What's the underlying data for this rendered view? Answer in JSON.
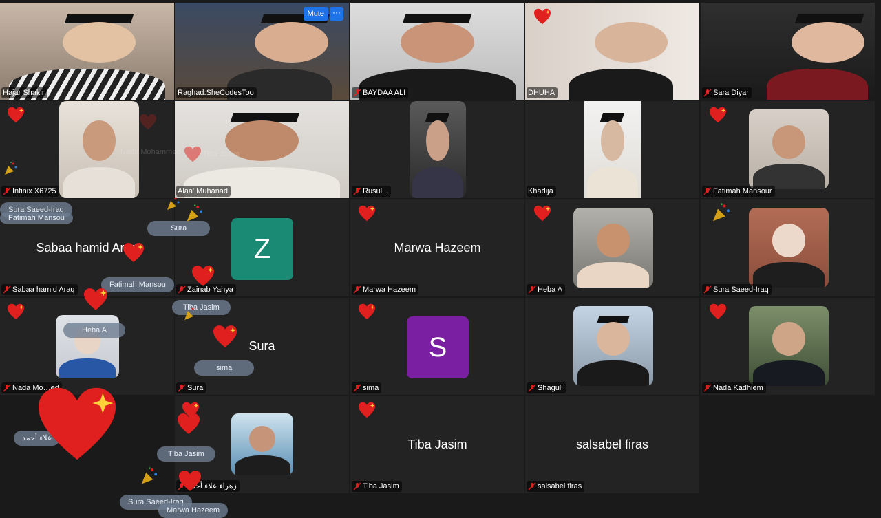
{
  "participants": [
    {
      "name": "Hajar Shakir",
      "mic_muted": false
    },
    {
      "name": "Raghad:SheCodesToo",
      "mic_muted": false
    },
    {
      "name": "BAYDAA ALI",
      "mic_muted": true
    },
    {
      "name": "DHUHA",
      "mic_muted": false
    },
    {
      "name": "Sara Diyar",
      "mic_muted": true
    },
    {
      "name": "Infinix X6725",
      "mic_muted": true
    },
    {
      "name": "Alaa' Muhanad",
      "mic_muted": false
    },
    {
      "name": "Rusul ..",
      "mic_muted": true
    },
    {
      "name": "Khadija",
      "mic_muted": false
    },
    {
      "name": "Fatimah Mansour",
      "mic_muted": true
    },
    {
      "name": "Sabaa hamid Araq",
      "mic_muted": true,
      "display_name": "Sabaa hamid Araq"
    },
    {
      "name": "Zainab Yahya",
      "mic_muted": true,
      "initial": "Z"
    },
    {
      "name": "Marwa Hazeem",
      "mic_muted": true,
      "display_name": "Marwa Hazeem"
    },
    {
      "name": "Heba A",
      "mic_muted": true
    },
    {
      "name": "Sura Saeed-Iraq",
      "mic_muted": true
    },
    {
      "name": "Nada Mohammed",
      "mic_muted": true,
      "label_shown": "Nada Mo…ed"
    },
    {
      "name": "Sura",
      "mic_muted": true,
      "display_name": "Sura"
    },
    {
      "name": "sima",
      "mic_muted": true,
      "initial": "S"
    },
    {
      "name": "Shagull",
      "mic_muted": true
    },
    {
      "name": "Nada Kadhiem",
      "mic_muted": true
    },
    {
      "name": "زهراء علاء أحمد",
      "mic_muted": true
    },
    {
      "name": "Tiba Jasim",
      "mic_muted": true,
      "display_name": "Tiba Jasim"
    },
    {
      "name": "salsabel firas",
      "mic_muted": true,
      "display_name": "salsabel firas"
    }
  ],
  "hover_controls": {
    "mute_label": "Mute",
    "more_label": "···"
  },
  "reaction_bubbles": [
    "Sura Saeed-Iraq",
    "Fatimah Mansou",
    "Sura",
    "Fatimah Mansou",
    "Tiba Jasim",
    "Heba A",
    "sima",
    "علاء أحمد",
    "Tiba Jasim",
    "Sura Saeed-Iraq",
    "Marwa Hazeem"
  ],
  "colors": {
    "active_speaker": "#2ecc40",
    "zainab_avatar": "#1a8a74",
    "sima_avatar": "#7b1fa2",
    "heart": "#e0201e",
    "button": "#1f73e8",
    "muted_mic": "#e02020"
  },
  "faded_text": {
    "ghost_1": "Nada Mohammed",
    "ghost_2": "Tiba Jasim"
  }
}
